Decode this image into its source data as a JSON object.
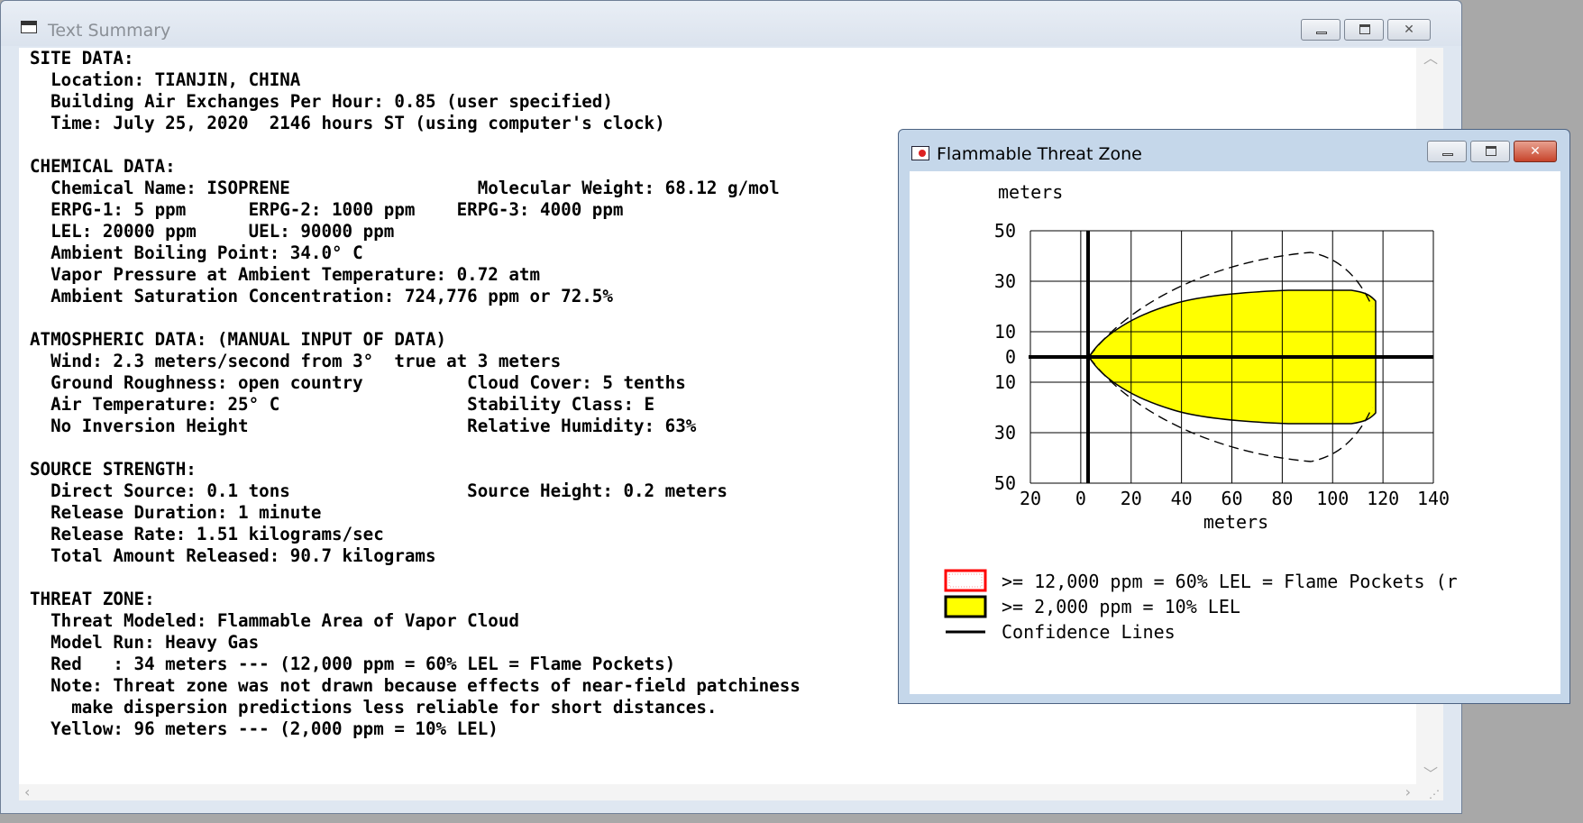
{
  "text_summary": {
    "title": "Text Summary",
    "lines": [
      "SITE DATA:",
      "  Location: TIANJIN, CHINA",
      "  Building Air Exchanges Per Hour: 0.85 (user specified)",
      "  Time: July 25, 2020  2146 hours ST (using computer's clock)",
      "",
      "CHEMICAL DATA:",
      "  Chemical Name: ISOPRENE                  Molecular Weight: 68.12 g/mol",
      "  ERPG-1: 5 ppm      ERPG-2: 1000 ppm    ERPG-3: 4000 ppm",
      "  LEL: 20000 ppm     UEL: 90000 ppm",
      "  Ambient Boiling Point: 34.0° C",
      "  Vapor Pressure at Ambient Temperature: 0.72 atm",
      "  Ambient Saturation Concentration: 724,776 ppm or 72.5%",
      "",
      "ATMOSPHERIC DATA: (MANUAL INPUT OF DATA)",
      "  Wind: 2.3 meters/second from 3°  true at 3 meters",
      "  Ground Roughness: open country          Cloud Cover: 5 tenths",
      "  Air Temperature: 25° C                  Stability Class: E",
      "  No Inversion Height                     Relative Humidity: 63%",
      "",
      "SOURCE STRENGTH:",
      "  Direct Source: 0.1 tons                 Source Height: 0.2 meters",
      "  Release Duration: 1 minute",
      "  Release Rate: 1.51 kilograms/sec",
      "  Total Amount Released: 90.7 kilograms",
      "",
      "THREAT ZONE:",
      "  Threat Modeled: Flammable Area of Vapor Cloud",
      "  Model Run: Heavy Gas",
      "  Red   : 34 meters --- (12,000 ppm = 60% LEL = Flame Pockets)",
      "  Note: Threat zone was not drawn because effects of near-field patchiness",
      "    make dispersion predictions less reliable for short distances.",
      "  Yellow: 96 meters --- (2,000 ppm = 10% LEL)"
    ]
  },
  "threat_zone_window": {
    "title": "Flammable Threat Zone",
    "y_unit_label": "meters",
    "x_unit_label": "meters",
    "y_tick_labels": [
      "50",
      "30",
      "10",
      "0",
      "10",
      "30",
      "50"
    ],
    "x_tick_labels": [
      "20",
      "0",
      "20",
      "40",
      "60",
      "80",
      "100",
      "120",
      "140"
    ],
    "legend": [
      {
        "text": ">= 12,000 ppm = 60% LEL = Flame Pockets (r",
        "swatch": "red-dotted"
      },
      {
        "text": ">= 2,000 ppm = 10% LEL",
        "swatch": "yellow"
      },
      {
        "text": "Confidence Lines",
        "swatch": "line"
      }
    ],
    "colors": {
      "yellow_zone": "#ffff00",
      "red_zone": "#ff0000",
      "line": "#000000"
    }
  }
}
